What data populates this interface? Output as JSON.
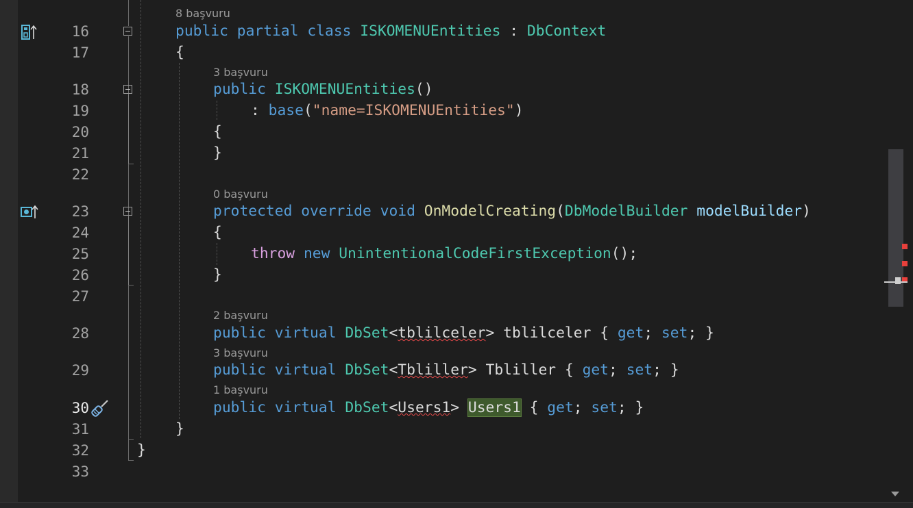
{
  "editor": {
    "line_numbers": [
      "16",
      "17",
      "18",
      "19",
      "20",
      "21",
      "22",
      "23",
      "24",
      "25",
      "26",
      "27",
      "28",
      "29",
      "30",
      "31",
      "32",
      "33"
    ],
    "current_line": "30",
    "references": {
      "class": "8 başvuru",
      "ctor": "3 başvuru",
      "onmodel": "0 başvuru",
      "tblilceler": "2 başvuru",
      "tbliller": "3 başvuru",
      "users1": "1 başvuru"
    },
    "tokens": {
      "public": "public",
      "partial": "partial",
      "class": "class",
      "class_name": "ISKOMENUEntities",
      "colon": " : ",
      "base_type": "DbContext",
      "open_brace": "{",
      "close_brace": "}",
      "ctor_name": "ISKOMENUEntities",
      "parens": "()",
      "base_colon": ": ",
      "base": "base",
      "open_paren": "(",
      "close_paren": ")",
      "base_arg": "\"name=ISKOMENUEntities\"",
      "protected": "protected",
      "override": "override",
      "void": "void",
      "method": "OnModelCreating",
      "param_type": "DbModelBuilder",
      "param_name": "modelBuilder",
      "throw": "throw",
      "new": "new",
      "exception": "UnintentionalCodeFirstException",
      "call_end": "();",
      "virtual": "virtual",
      "dbset": "DbSet",
      "lt": "<",
      "gt": ">",
      "t1": "tblilceler",
      "p1": "tblilceler",
      "t2": "Tbliller",
      "p2": "Tbliller",
      "t3": "Users1",
      "p3": "Users1",
      "acc_open": " { ",
      "get": "get",
      "semi": "; ",
      "set": "set",
      "acc_close": "; }"
    }
  },
  "colors": {
    "background": "#1e1e1e",
    "keyword": "#569cd6",
    "control_keyword": "#d8a0df",
    "type": "#4ec9b0",
    "method": "#dcdcaa",
    "string": "#d69d85",
    "parameter": "#9cdcfe",
    "error_squiggle": "#e84a4a",
    "highlight": "#3e5a2c"
  },
  "icons": {
    "line16": "implementation-up-icon",
    "line23": "override-up-icon",
    "line30": "screwdriver-quick-action-icon"
  }
}
